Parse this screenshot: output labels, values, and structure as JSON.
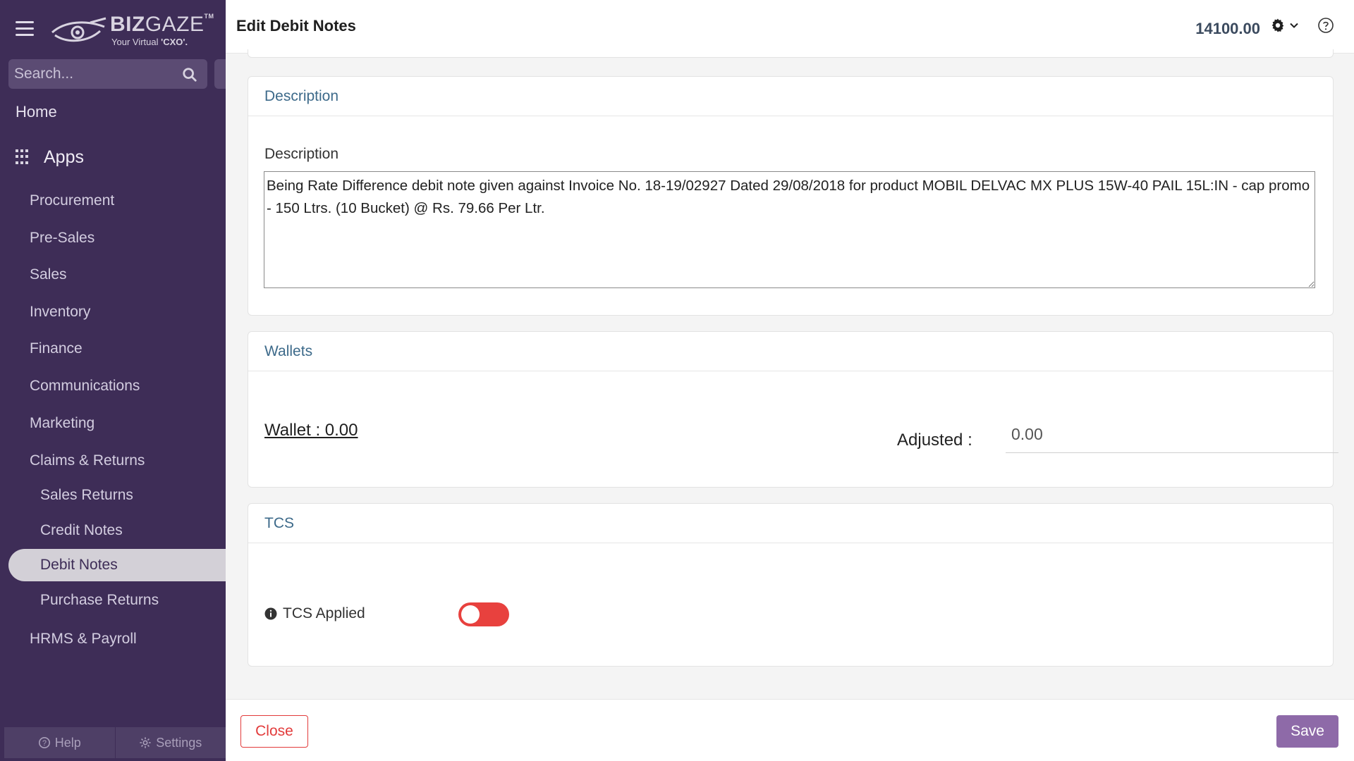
{
  "brand": {
    "name_bold": "BIZ",
    "name_light": "GAZE",
    "trademark": "TM",
    "tagline_prefix": "Your Virtual ",
    "tagline_bold": "'CXO'."
  },
  "search": {
    "placeholder": "Search..."
  },
  "sidebar": {
    "home": "Home",
    "apps": "Apps",
    "items": [
      {
        "label": "Procurement"
      },
      {
        "label": "Pre-Sales"
      },
      {
        "label": "Sales"
      },
      {
        "label": "Inventory"
      },
      {
        "label": "Finance"
      },
      {
        "label": "Communications"
      },
      {
        "label": "Marketing"
      },
      {
        "label": "Claims & Returns"
      }
    ],
    "sub_items": [
      {
        "label": "Sales Returns"
      },
      {
        "label": "Credit Notes"
      },
      {
        "label": "Debit Notes",
        "active": true
      },
      {
        "label": "Purchase Returns"
      }
    ],
    "hrms": "HRMS & Payroll",
    "footer": {
      "help": "Help",
      "settings": "Settings"
    }
  },
  "header": {
    "title": "Edit Debit Notes",
    "amount": "14100.00"
  },
  "description_section": {
    "title": "Description",
    "field_label": "Description",
    "value": "Being Rate Difference debit note given against Invoice No. 18-19/02927 Dated 29/08/2018 for product MOBIL DELVAC MX PLUS 15W-40 PAIL 15L:IN - cap promo - 150 Ltrs. (10 Bucket) @ Rs. 79.66 Per Ltr."
  },
  "wallets_section": {
    "title": "Wallets",
    "wallet_link": "Wallet : 0.00",
    "adjusted_label": "Adjusted :",
    "adjusted_value": "0.00"
  },
  "tcs_section": {
    "title": "TCS",
    "label": "TCS Applied",
    "enabled": false
  },
  "actions": {
    "close": "Close",
    "save": "Save"
  },
  "colors": {
    "sidebar_bg": "#3e2d57",
    "accent": "#8e6aa8",
    "danger": "#e23b3b",
    "section_title": "#3d6a8a"
  },
  "icons": [
    "hamburger-icon",
    "search-icon",
    "apps-grid-icon",
    "help-circle-icon",
    "settings-gear-icon",
    "gear-icon",
    "chevron-down-icon",
    "question-circle-icon",
    "info-icon"
  ]
}
